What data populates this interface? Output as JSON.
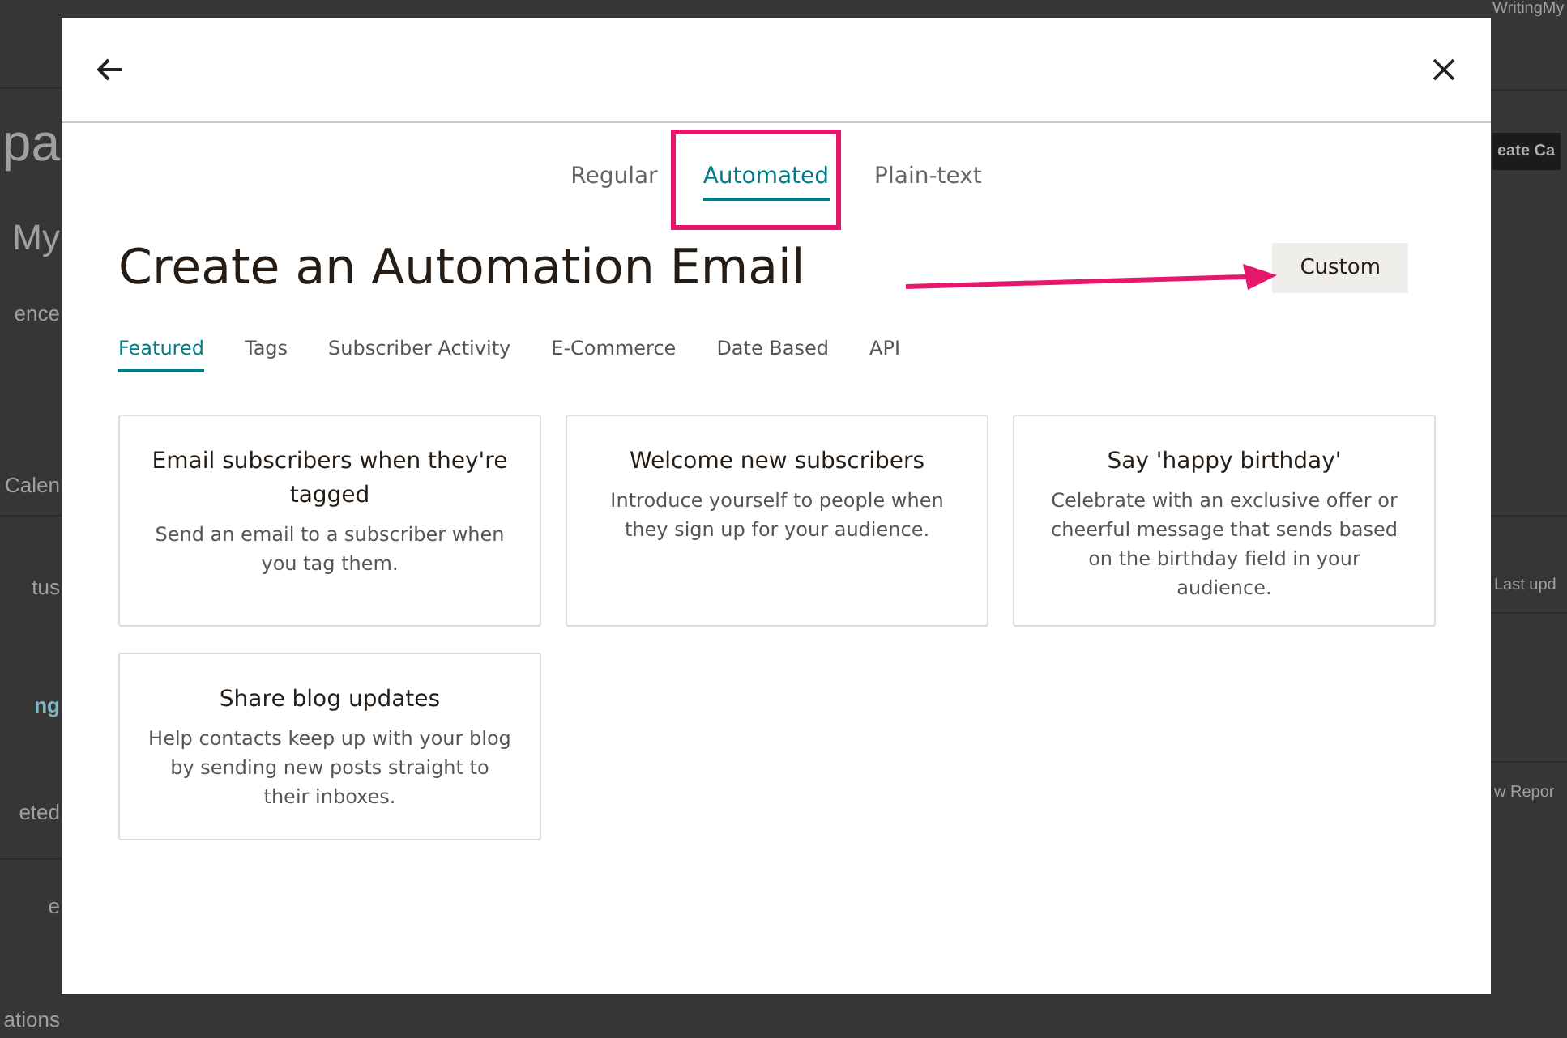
{
  "background": {
    "left_fragments": [
      {
        "text": "pa",
        "kind": "heading"
      },
      {
        "text": "My",
        "kind": "subheading"
      },
      {
        "text": "ence",
        "kind": "plain"
      },
      {
        "text": "Calen",
        "kind": "plain"
      },
      {
        "text": "tus",
        "kind": "plain"
      },
      {
        "text": "ng",
        "kind": "link"
      },
      {
        "text": "eted",
        "kind": "plain"
      },
      {
        "text": "e",
        "kind": "plain"
      },
      {
        "text": "ations",
        "kind": "plain"
      }
    ],
    "right_fragments": [
      {
        "text": "WritingMy",
        "kind": "plain"
      },
      {
        "text": "eate Ca",
        "kind": "button"
      },
      {
        "text": "Last upd",
        "kind": "plain"
      },
      {
        "text": "w Repor",
        "kind": "plain"
      }
    ]
  },
  "modal": {
    "type_tabs": [
      {
        "label": "Regular",
        "selected": false
      },
      {
        "label": "Automated",
        "selected": true
      },
      {
        "label": "Plain-text",
        "selected": false
      }
    ],
    "title": "Create an Automation Email",
    "custom_button": "Custom",
    "category_tabs": [
      {
        "label": "Featured",
        "selected": true
      },
      {
        "label": "Tags",
        "selected": false
      },
      {
        "label": "Subscriber Activity",
        "selected": false
      },
      {
        "label": "E-Commerce",
        "selected": false
      },
      {
        "label": "Date Based",
        "selected": false
      },
      {
        "label": "API",
        "selected": false
      }
    ],
    "cards": [
      {
        "title": "Email subscribers when they're tagged",
        "description": "Send an email to a subscriber when you tag them."
      },
      {
        "title": "Welcome new subscribers",
        "description": "Introduce yourself to people when they sign up for your audience."
      },
      {
        "title": "Say 'happy birthday'",
        "description": "Celebrate with an exclusive offer or cheerful message that sends based on the birthday field in your audience."
      },
      {
        "title": "Share blog updates",
        "description": "Help contacts keep up with your blog by sending new posts straight to their inboxes."
      }
    ]
  }
}
